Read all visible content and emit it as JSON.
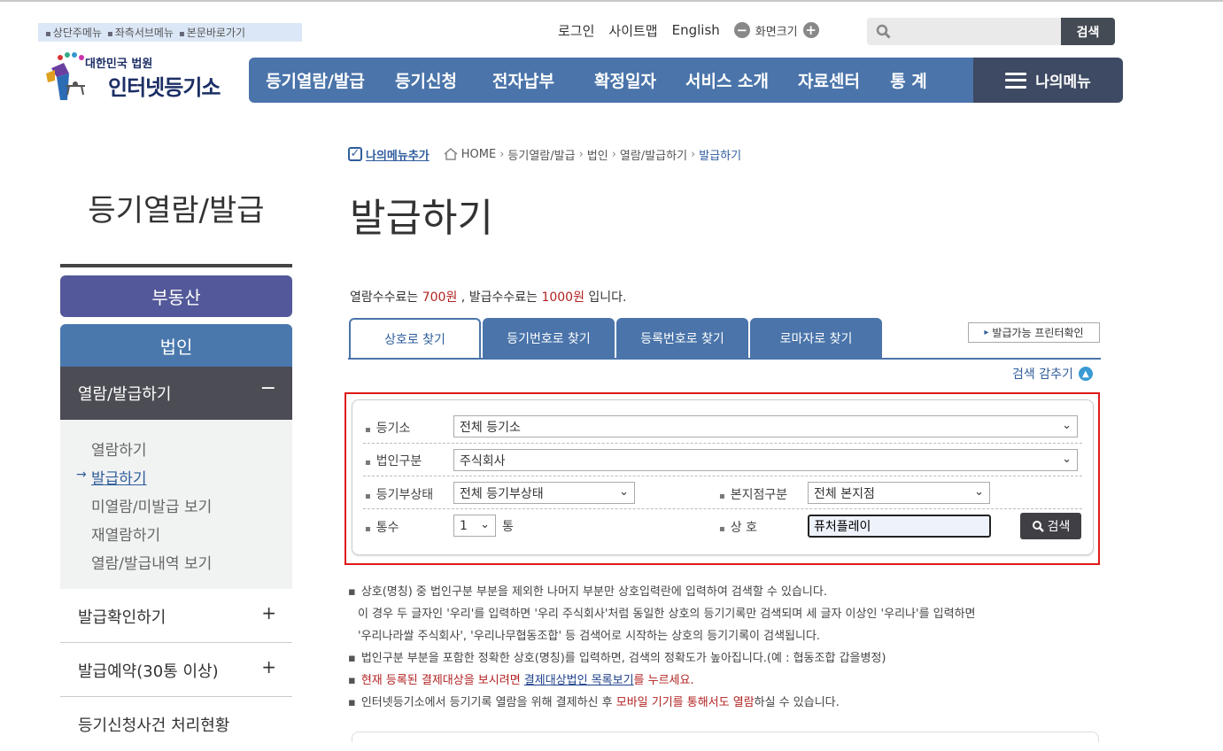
{
  "skip_nav": [
    "상단주메뉴",
    "좌측서브메뉴",
    "본문바로가기"
  ],
  "logo": {
    "sub": "대한민국 법원",
    "main": "인터넷등기소"
  },
  "util": {
    "login": "로그인",
    "sitemap": "사이트맵",
    "english": "English",
    "zoom_label": "화면크기"
  },
  "top_search": {
    "value": "",
    "button": "검색"
  },
  "gnb": [
    "등기열람/발급",
    "등기신청",
    "전자납부",
    "확정일자",
    "서비스 소개",
    "자료센터",
    "통 계"
  ],
  "my_menu": "나의메뉴",
  "sidebar": {
    "title": "등기열람/발급",
    "realestate": "부동산",
    "corp": "법인",
    "open_item": "열람/발급하기",
    "open_marker": "−",
    "sub": [
      "열람하기",
      "발급하기",
      "미열람/미발급 보기",
      "재열람하기",
      "열람/발급내역 보기"
    ],
    "sub_active_arrow": "→",
    "others": [
      "발급확인하기",
      "발급예약(30통 이상)",
      "등기신청사건 처리현황"
    ],
    "plus": "+"
  },
  "breadcrumb": {
    "add": "나의메뉴추가",
    "items": [
      "HOME",
      "등기열람/발급",
      "법인",
      "열람/발급하기"
    ],
    "current": "발급하기"
  },
  "page_title": "발급하기",
  "fee": {
    "t1": "열람수수료는 ",
    "v1": "700원",
    "t2": " , 발급수수료는 ",
    "v2": "1000원",
    "t3": " 입니다."
  },
  "tabs": [
    "상호로 찾기",
    "등기번호로 찾기",
    "등록번호로 찾기",
    "로마자로 찾기"
  ],
  "printer_check": "발급가능 프린터확인",
  "hide_search": "검색 감추기",
  "form": {
    "registry_label": "등기소",
    "registry_value": "전체 등기소",
    "corp_type_label": "법인구분",
    "corp_type_value": "주식회사",
    "status_label": "등기부상태",
    "status_value": "전체 등기부상태",
    "branch_label": "본지점구분",
    "branch_value": "전체 본지점",
    "copies_label": "통수",
    "copies_value": "1",
    "copies_unit": "통",
    "name_label": "상 호",
    "name_value": "퓨처플레이",
    "search_button": "검색"
  },
  "notes": {
    "n1": "상호(명칭) 중 법인구분 부분을 제외한 나머지 부분만 상호입력란에 입력하여 검색할 수 있습니다.",
    "n1b": "이 경우 두 글자인 '우리'를 입력하면 '우리 주식회사'처럼 동일한 상호의 등기기록만 검색되며 세 글자 이상인 '우리나'를 입력하면",
    "n1c": "'우리나라쌀 주식회사', '우리나무협동조합' 등 검색어로 시작하는 상호의 등기기록이 검색됩니다.",
    "n2": "법인구분 부분을 포함한 정확한 상호(명칭)를 입력하면, 검색의 정확도가 높아집니다.(예 : 협동조합 갑을병정)",
    "n3a": "현재 등록된 결제대상을 보시려면 ",
    "n3link": "결제대상법인 목록보기",
    "n3b": "를 누르세요.",
    "n4a": "인터넷등기소에서 등기기록 열람을 위해 결제하신 후 ",
    "n4red": "모바일 기기를 통해서도 열람",
    "n4b": "하실 수 있습니다."
  }
}
